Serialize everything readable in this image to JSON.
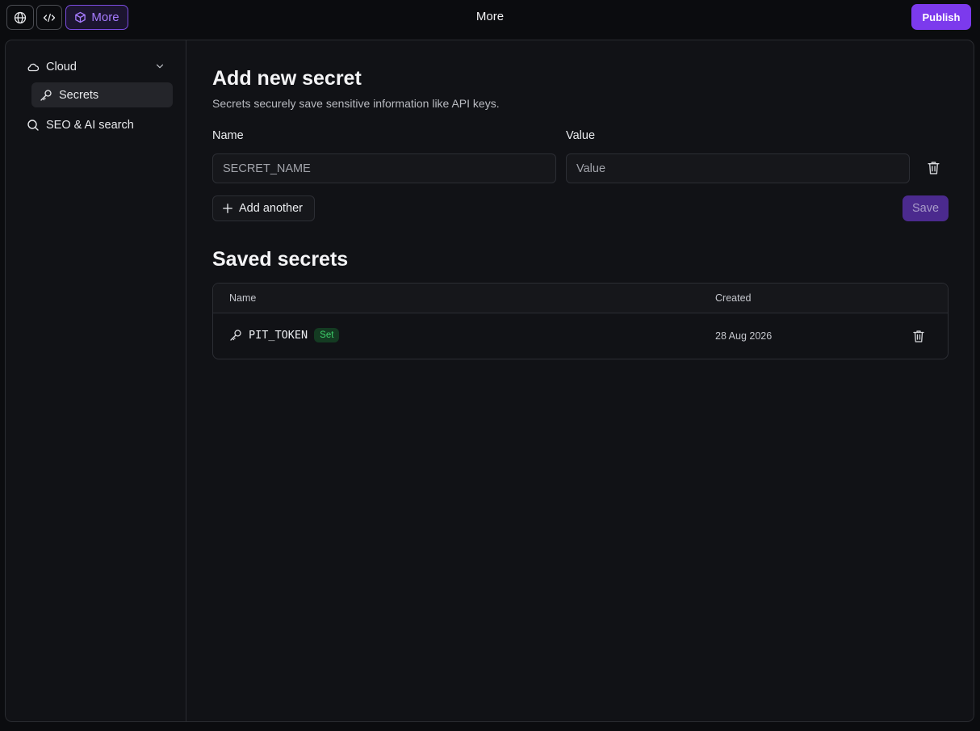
{
  "topbar": {
    "more_label": "More",
    "title": "More",
    "publish_label": "Publish"
  },
  "sidebar": {
    "items": [
      {
        "label": "Cloud",
        "icon": "cloud-icon"
      },
      {
        "label": "Secrets",
        "icon": "key-icon",
        "active": true
      },
      {
        "label": "SEO & AI search",
        "icon": "search-icon"
      }
    ]
  },
  "form": {
    "title": "Add new secret",
    "subtitle": "Secrets securely save sensitive information like API keys.",
    "name_label": "Name",
    "value_label": "Value",
    "name_placeholder": "SECRET_NAME",
    "value_placeholder": "Value",
    "add_another_label": "Add another",
    "save_label": "Save"
  },
  "saved": {
    "title": "Saved secrets",
    "columns": {
      "name": "Name",
      "created": "Created"
    },
    "rows": [
      {
        "name": "PIT_TOKEN",
        "status": "Set",
        "created": "28 Aug 2026"
      }
    ]
  },
  "colors": {
    "accent": "#7c3aed",
    "background": "#0b0c0f",
    "panel": "#111216",
    "badge_green": "#3ecf6b"
  }
}
